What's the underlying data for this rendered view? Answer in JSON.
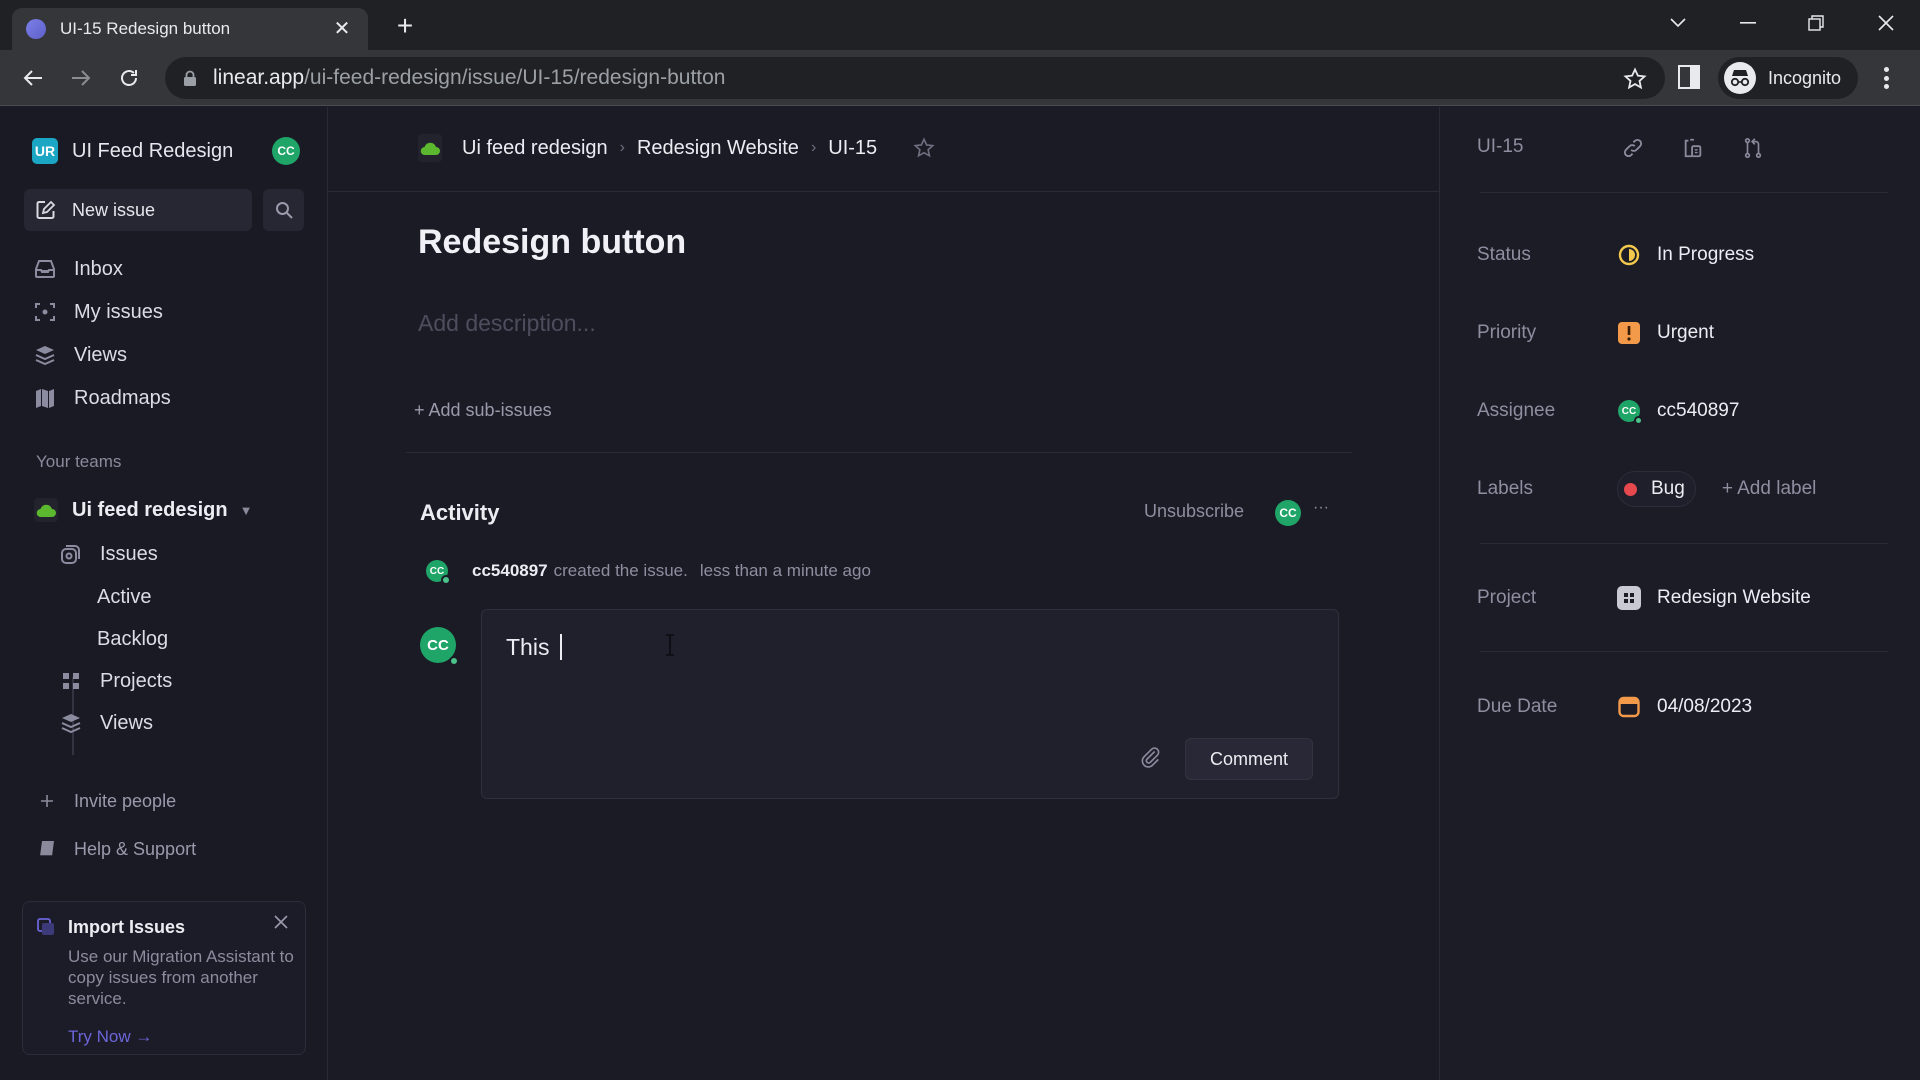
{
  "browser": {
    "tab_title": "UI-15 Redesign button",
    "url_host": "linear.app",
    "url_path": "/ui-feed-redesign/issue/UI-15/redesign-button",
    "profile_label": "Incognito"
  },
  "sidebar": {
    "workspace_initials": "UR",
    "workspace_name": "UI Feed Redesign",
    "user_initials": "CC",
    "new_issue_label": "New issue",
    "nav": [
      {
        "label": "Inbox",
        "icon": "inbox-icon"
      },
      {
        "label": "My issues",
        "icon": "my-issues-icon"
      },
      {
        "label": "Views",
        "icon": "layers-icon"
      },
      {
        "label": "Roadmaps",
        "icon": "map-icon"
      }
    ],
    "teams_section_label": "Your teams",
    "team": {
      "name": "Ui feed redesign",
      "items": [
        {
          "label": "Issues",
          "icon": "issues-icon"
        },
        {
          "label": "Active",
          "icon": ""
        },
        {
          "label": "Backlog",
          "icon": ""
        },
        {
          "label": "Projects",
          "icon": "grid-icon"
        },
        {
          "label": "Views",
          "icon": "layers-icon"
        }
      ]
    },
    "invite_label": "Invite people",
    "help_label": "Help & Support",
    "import_card": {
      "title": "Import Issues",
      "body": "Use our Migration Assistant to copy issues from another service.",
      "cta": "Try Now →"
    }
  },
  "main": {
    "breadcrumbs": [
      "Ui feed redesign",
      "Redesign Website",
      "UI-15"
    ],
    "title": "Redesign button",
    "description_placeholder": "Add description...",
    "add_sub_issues": "+ Add sub-issues",
    "activity": {
      "heading": "Activity",
      "unsubscribe_label": "Unsubscribe",
      "subscriber_initials": "CC",
      "events": [
        {
          "user": "cc540897",
          "initials": "CC",
          "text": "created the issue.",
          "time": "less than a minute ago"
        }
      ]
    },
    "comment": {
      "author_initials": "CC",
      "draft_text": "This ",
      "submit_label": "Comment"
    }
  },
  "details": {
    "issue_id": "UI-15",
    "properties": {
      "status": {
        "label": "Status",
        "value": "In Progress",
        "color": "#f2c94c"
      },
      "priority": {
        "label": "Priority",
        "value": "Urgent",
        "color": "#f2994a"
      },
      "assignee": {
        "label": "Assignee",
        "value": "cc540897",
        "initials": "CC"
      },
      "labels": {
        "label": "Labels",
        "chips": [
          {
            "name": "Bug",
            "color": "#e5484d"
          }
        ],
        "add_label": "+ Add label"
      },
      "project": {
        "label": "Project",
        "value": "Redesign Website"
      },
      "due_date": {
        "label": "Due Date",
        "value": "04/08/2023",
        "color": "#f2994a"
      }
    }
  }
}
